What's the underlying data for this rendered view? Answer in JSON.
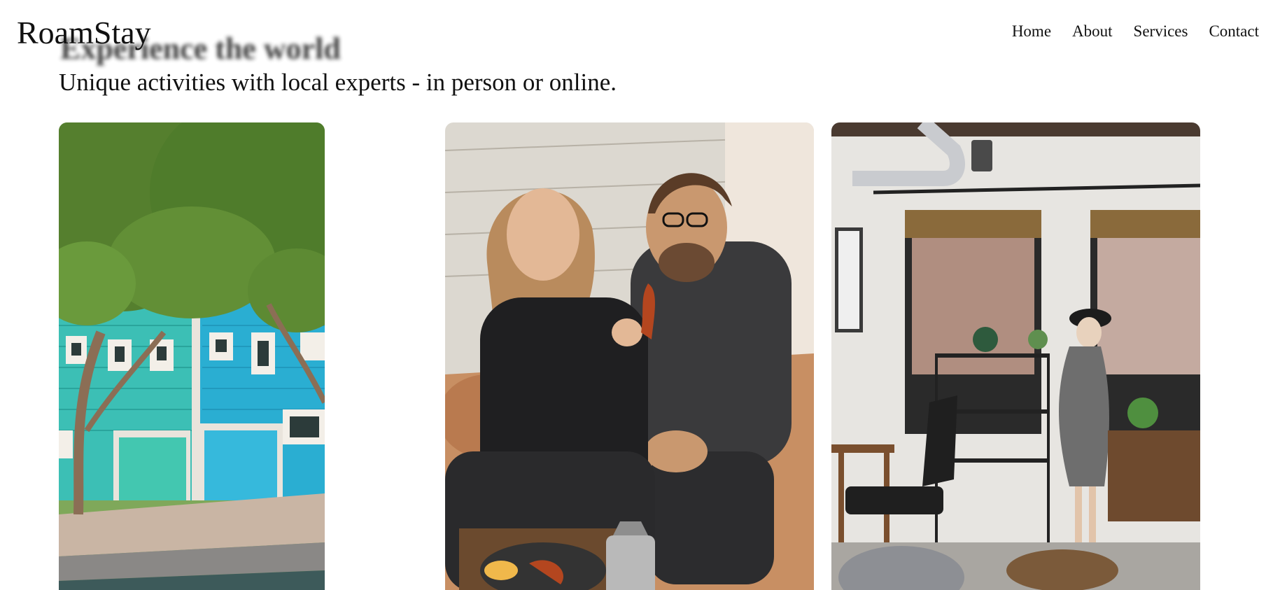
{
  "header": {
    "logo": "RoamStay",
    "nav": [
      {
        "label": "Home"
      },
      {
        "label": "About"
      },
      {
        "label": "Services"
      },
      {
        "label": "Contact"
      }
    ]
  },
  "hero": {
    "title": "Experience the world",
    "subtitle": "Unique activities with local experts - in person or online."
  },
  "colors": {
    "background": "#ffffff",
    "text": "#111111",
    "house_teal": "#2fb7b0",
    "house_blue": "#2aa8d0",
    "tree_green": "#4e7a2a"
  }
}
